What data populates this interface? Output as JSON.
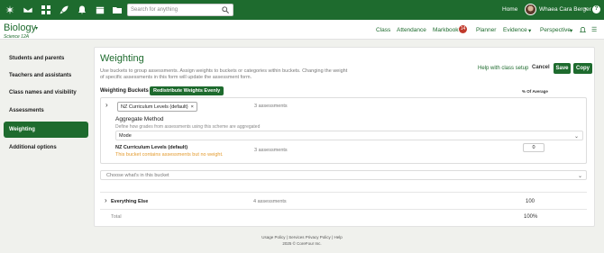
{
  "topbar": {
    "search_placeholder": "Search for anything",
    "home": "Home",
    "user_name": "Whaea Cara Berger",
    "help": "?"
  },
  "subheader": {
    "class_title": "Biology",
    "class_sub": "Science 12A",
    "nav": [
      "Class",
      "Attendance",
      "Markbook",
      "Planner",
      "Evidence",
      "Perspective"
    ],
    "markbook_badge": "14"
  },
  "sidebar": {
    "items": [
      {
        "label": "Students and parents"
      },
      {
        "label": "Teachers and assistants"
      },
      {
        "label": "Class names and visibility"
      },
      {
        "label": "Assessments"
      },
      {
        "label": "Weighting"
      },
      {
        "label": "Additional options"
      }
    ]
  },
  "main": {
    "title": "Weighting",
    "description": "Use buckets to group assessments. Assign weights to buckets or categories within buckets. Changing the weight of specific assessments in this form will update the assessment form.",
    "help_link": "Help with class setup",
    "cancel": "Cancel",
    "save": "Save",
    "copy": "Copy",
    "weighting_buckets_label": "Weighting Buckets",
    "redistribute": "Redistribute Weights Evenly",
    "pct_of_average": "% Of Average",
    "bucket": {
      "tag": "NZ Curriculum Levels (default)",
      "tag_remove": "×",
      "count_top": "3 assessments",
      "aggregate_title": "Aggregate Method",
      "aggregate_desc": "Define how grades from assessments using this scheme are aggregated",
      "mode": "Mode",
      "name": "NZ Curriculum Levels (default)",
      "warning": "This bucket contains assessments but no weight.",
      "count": "3 assessments",
      "weight": "0"
    },
    "choose_placeholder": "Choose what's in this bucket",
    "everything_else": {
      "name": "Everything Else",
      "count": "4 assessments",
      "weight": "100"
    },
    "total": {
      "label": "Total",
      "value": "100%"
    }
  },
  "footer": {
    "usage_policy": "Usage Policy",
    "separator1": "|",
    "services_privacy": "Services Privacy Policy",
    "separator2": "|",
    "help": "Help",
    "copyright": "2025 © CoreFour Inc."
  }
}
